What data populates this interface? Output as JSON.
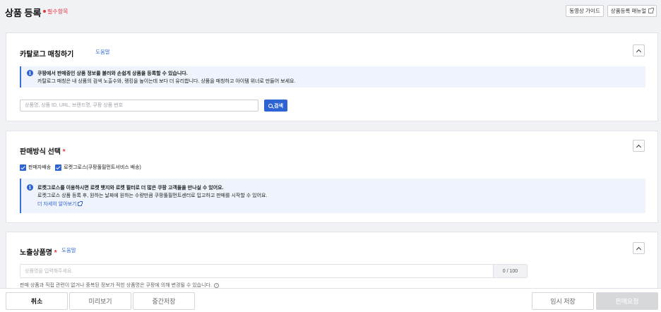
{
  "header": {
    "title": "상품 등록",
    "required_label": "필수항목",
    "video_guide_label": "동영상 가이드",
    "manual_label": "상품등록 매뉴얼"
  },
  "catalog": {
    "title": "카탈로그 매칭하기",
    "help_label": "도움말",
    "info_bold": "쿠팡에서 판매중인 상품 정보를 불러와 손쉽게 상품을 등록할 수 있습니다.",
    "info_text": "카탈로그 매칭은 내 상품의 검색 노출수와, 랭킹을 높이는데 보다 더 유리합니다. 상품을 매칭하고 아이템 위너로 만들어 보세요.",
    "search_placeholder": "상품명, 상품 ID, URL, 브랜드명, 쿠팡 상품 번호",
    "search_button": "검색"
  },
  "sales_method": {
    "title": "판매방식 선택",
    "required_mark": "*",
    "options": [
      {
        "label": "판매자배송",
        "checked": true
      },
      {
        "label": "로켓그로스(쿠팡풀필먼트서비스 배송)",
        "checked": true
      }
    ],
    "info_bold": "로켓그로스를 이용하시면 로켓 뱃지와 로켓 필터로 더 많은 쿠팡 고객들을 만나실 수 있어요.",
    "info_text": "로켓그로스 상품 등록 후, 원하는 날짜에 원하는 수량만큼 쿠팡풀필먼트센터로 입고하고 판매를 시작할 수 있어요.",
    "info_link": "더 자세히 알아보기"
  },
  "display_name": {
    "title": "노출상품명",
    "required_mark": "*",
    "help_label": "도움말",
    "placeholder": "상품명을 입력해주세요.",
    "count": "0 / 100",
    "note": "판매 상품과 직접 관련이 없거나 중복된 정보가 적힌 상품명은 쿠팡에 의해 변경될 수 있습니다."
  },
  "footer": {
    "cancel": "취소",
    "preview": "미리보기",
    "save_mid": "중간저장",
    "temp_save": "임시 저장",
    "request_sale": "판매요청"
  },
  "colors": {
    "accent": "#2d63d4",
    "required": "#e8353d",
    "info_bg": "#eef3fc"
  }
}
